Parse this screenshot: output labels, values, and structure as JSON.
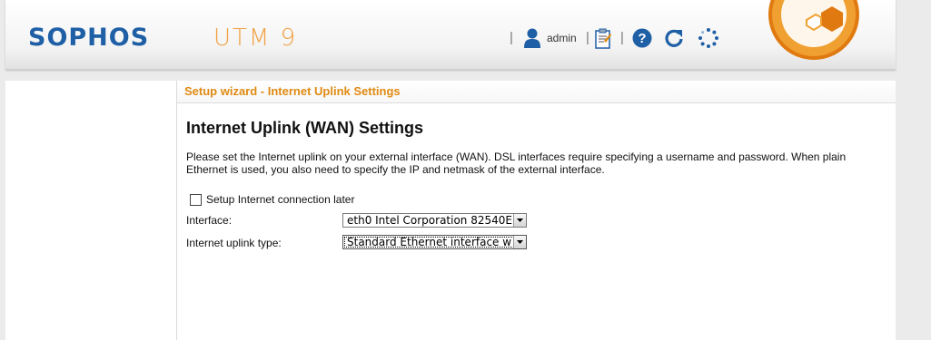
{
  "header": {
    "brand": "SOPHOS",
    "product": "UTM 9",
    "separator": "|",
    "user": "admin",
    "icons": [
      "user-icon",
      "clipboard-icon",
      "help-icon",
      "reload-icon",
      "spinner-icon"
    ]
  },
  "colors": {
    "brand_blue": "#1f5fa6",
    "accent_orange": "#e08a12",
    "logo_orange": "#f0a030"
  },
  "panel": {
    "title": "Setup wizard - Internet Uplink Settings",
    "heading": "Internet Uplink (WAN) Settings",
    "description": "Please set the Internet uplink on your external interface (WAN). DSL interfaces require specifying a username and password. When plain Ethernet is used, you also need to specify the IP and netmask of the external interface.",
    "setup_later": {
      "label": "Setup Internet connection later",
      "checked": false
    },
    "interface": {
      "label": "Interface:",
      "value": "eth0 Intel Corporation 82540E"
    },
    "uplink_type": {
      "label": "Internet uplink type:",
      "value": "Standard Ethernet interface w"
    }
  }
}
